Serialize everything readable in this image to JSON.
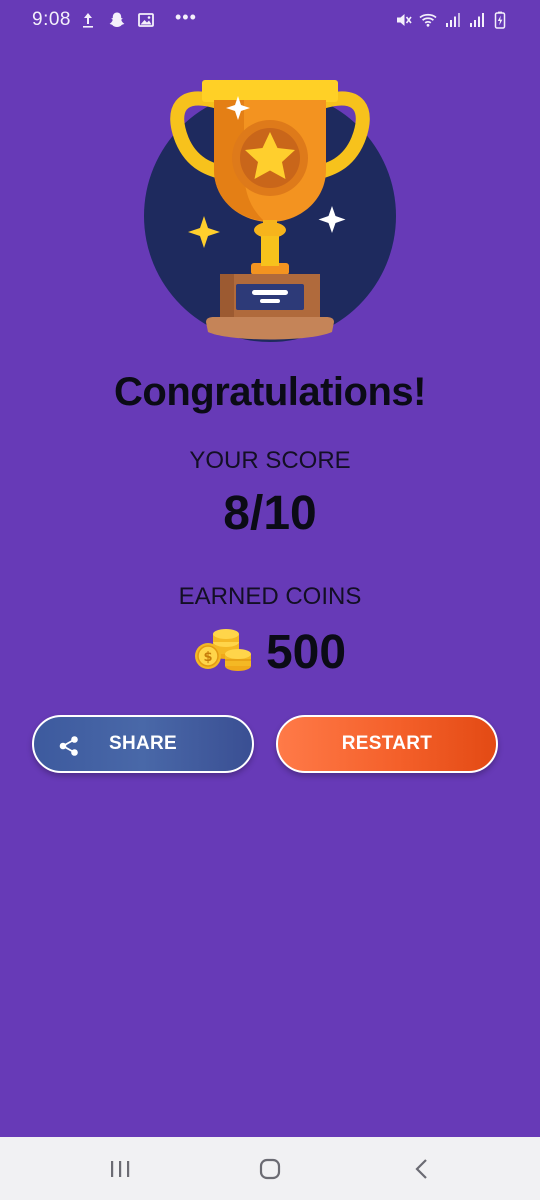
{
  "status_bar": {
    "time": "9:08",
    "left_icons": [
      "upload-icon",
      "snapchat-ghost-icon",
      "gallery-icon",
      "more-dots-icon"
    ],
    "more_dots": "•••",
    "right_icons": [
      "mute-icon",
      "wifi-icon",
      "signal-icon",
      "signal-icon",
      "battery-icon"
    ]
  },
  "result": {
    "title": "Congratulations!",
    "score_label": "YOUR SCORE",
    "score_value": "8/10",
    "coins_label": "EARNED COINS",
    "coins_value": "500"
  },
  "actions": {
    "share_label": "SHARE",
    "restart_label": "RESTART"
  },
  "nav_bar": {
    "items": [
      "recent-apps-icon",
      "home-icon",
      "back-icon"
    ]
  },
  "colors": {
    "background": "#673ab7",
    "trophy_circle": "#1e2a5e",
    "trophy_gold": "#f5a623",
    "share_button": "#4968a8",
    "restart_button": "#f4602a",
    "nav_bar": "#f1f1f3"
  }
}
